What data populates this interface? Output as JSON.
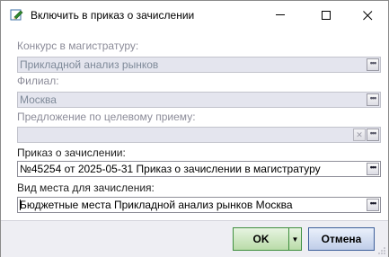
{
  "window": {
    "title": "Включить в приказ о зачислении",
    "icon": "edit-pencil-icon",
    "minimize_glyph": "—",
    "maximize_glyph": "☐",
    "close_glyph": "✕"
  },
  "form": {
    "competition": {
      "label": "Конкурс в магистратуру:",
      "value": "Прикладной анализ рынков",
      "state": "disabled"
    },
    "branch": {
      "label": "Филиал:",
      "value": "Москва",
      "state": "disabled"
    },
    "target_offer": {
      "label": "Предложение по целевому приему:",
      "value": "",
      "state": "disabled"
    },
    "order": {
      "label": "Приказ о зачислении:",
      "value": "№45254 от 2025-05-31 Приказ о зачислении в магистратуру",
      "state": "enabled"
    },
    "place_type": {
      "label": "Вид места для зачисления:",
      "value": "Бюджетные места Прикладной анализ рынков Москва",
      "state": "enabled"
    },
    "ellipsis_glyph": "•••",
    "clear_glyph": "✕"
  },
  "buttons": {
    "ok_label": "OK",
    "dropdown_glyph": "▼",
    "cancel_label": "Отмена"
  },
  "colors": {
    "ok_accent": "#3f8f3f",
    "cancel_accent": "#3d5f9a",
    "disabled_field_bg": "#e4e5ee"
  }
}
